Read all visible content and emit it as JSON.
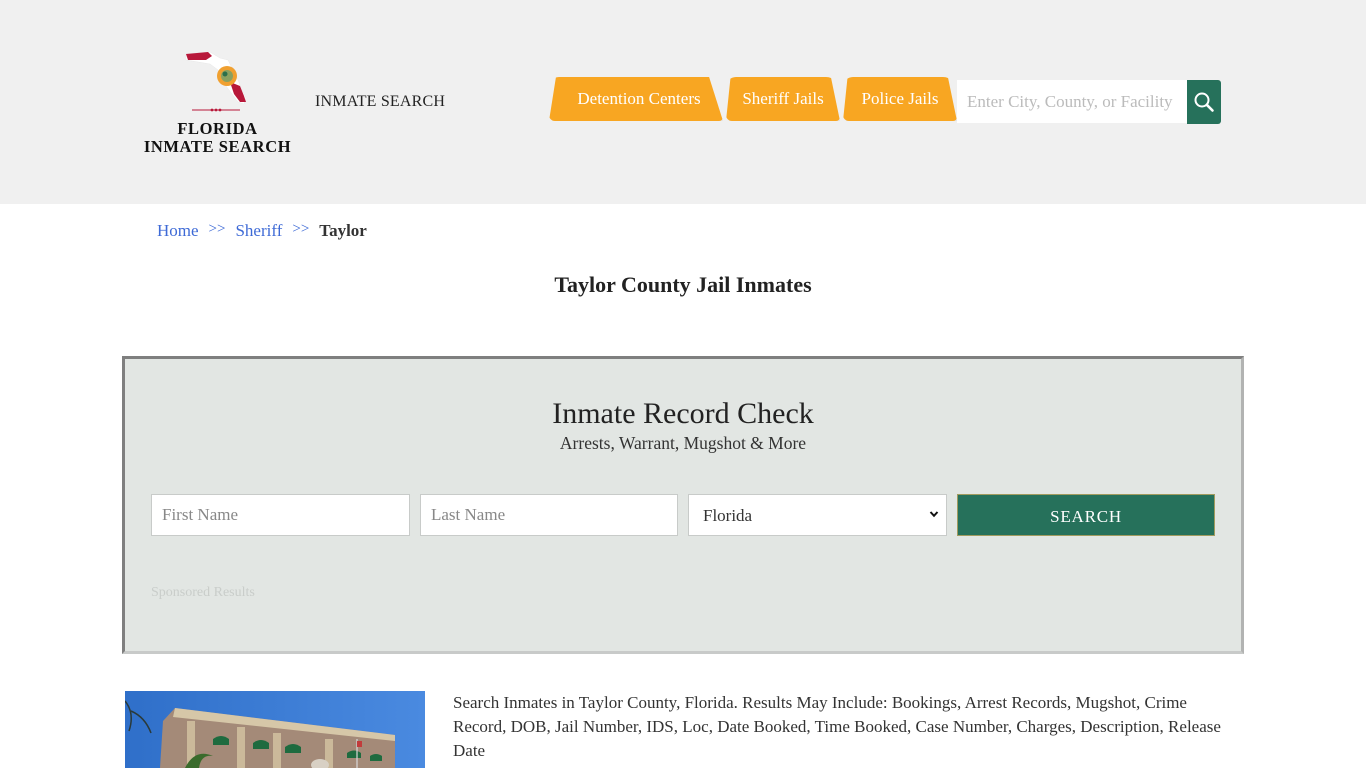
{
  "header": {
    "logo": {
      "line1": "FLORIDA",
      "line2": "INMATE SEARCH",
      "icon": "florida-map-flag-icon"
    },
    "brand_link": "INMATE SEARCH",
    "nav": [
      {
        "label": "Detention Centers"
      },
      {
        "label": "Sheriff Jails"
      },
      {
        "label": "Police Jails"
      }
    ],
    "search": {
      "placeholder": "Enter City, County, or Facility",
      "value": "",
      "icon": "search-icon"
    }
  },
  "breadcrumb": {
    "items": [
      {
        "label": "Home"
      },
      {
        "label": "Sheriff"
      },
      {
        "label": "Taylor"
      }
    ],
    "separator": ">>"
  },
  "page_title": "Taylor County Jail Inmates",
  "record_check": {
    "title": "Inmate Record Check",
    "subtitle": "Arrests, Warrant, Mugshot & More",
    "first_name_placeholder": "First Name",
    "last_name_placeholder": "Last Name",
    "state_selected": "Florida",
    "search_button": "SEARCH",
    "sponsored_label": "Sponsored Results"
  },
  "content": {
    "description": "Search Inmates in Taylor County, Florida. Results May Include: Bookings, Arrest Records, Mugshot, Crime Record, DOB, Jail Number, IDS, Loc, Date Booked, Time Booked, Case Number, Charges, Description, Release Date",
    "image_alt": "Taylor County Jail building"
  },
  "colors": {
    "accent_orange": "#f8a622",
    "accent_green": "#26715b",
    "link_blue": "#3e6ad6",
    "header_bg": "#f0f0f0",
    "panel_bg": "#e2e6e3"
  }
}
